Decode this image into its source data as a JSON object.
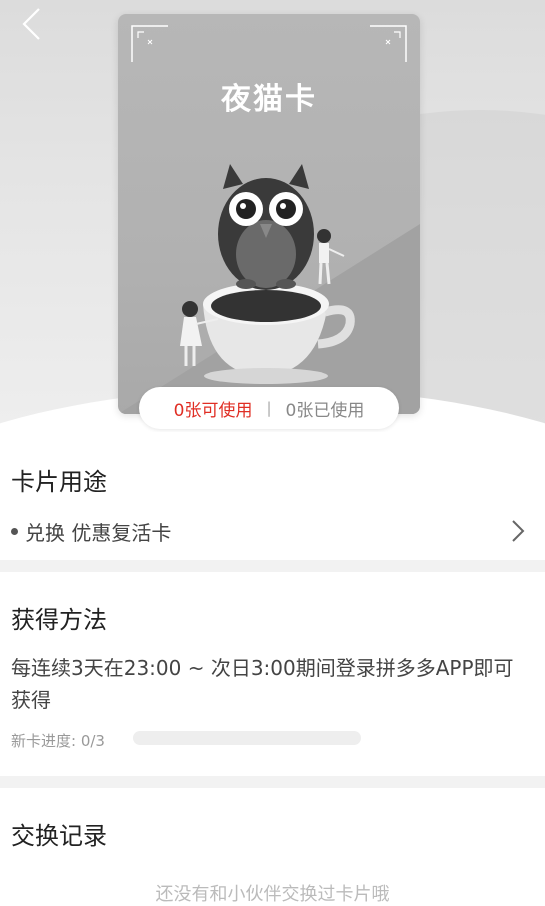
{
  "card": {
    "title": "夜猫卡"
  },
  "usage": {
    "available": "0张可使用",
    "separator": "|",
    "used": "0张已使用"
  },
  "purpose": {
    "title": "卡片用途",
    "item": "兑换 优惠复活卡"
  },
  "obtain": {
    "title": "获得方法",
    "description": "每连续3天在23:00 ~ 次日3:00期间登录拼多多APP即可获得",
    "progress_label": "新卡进度: 0/3",
    "progress_fraction": 0
  },
  "exchange": {
    "title": "交换记录",
    "empty_hint": "还没有和小伙伴交换过卡片哦"
  },
  "colors": {
    "accent": "#e02e24"
  }
}
